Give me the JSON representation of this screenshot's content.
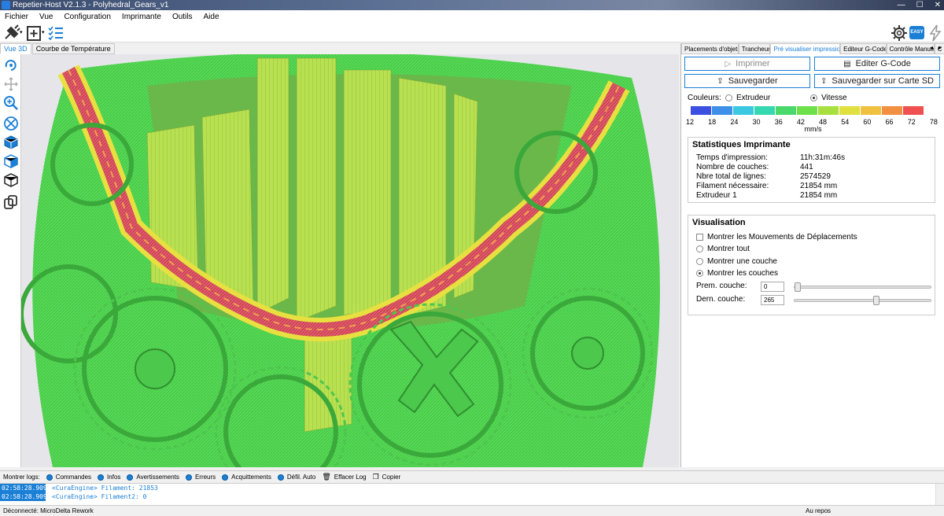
{
  "window": {
    "title": "Repetier-Host V2.1.3 - Polyhedral_Gears_v1"
  },
  "menu": [
    "Fichier",
    "Vue",
    "Configuration",
    "Imprimante",
    "Outils",
    "Aide"
  ],
  "toolbar": {
    "easy_badge": "EASY"
  },
  "view_tabs": [
    "Vue 3D",
    "Courbe de Température"
  ],
  "panel_tabs": [
    "Placements d'objets",
    "Trancheur",
    "Pré visualiser impression",
    "Editeur G-Code",
    "Contrôle Manuel",
    "C"
  ],
  "actions": {
    "print": "Imprimer",
    "edit_gcode": "Editer G-Code",
    "save": "Sauvegarder",
    "save_sd": "Sauvegarder sur Carte SD"
  },
  "colors": {
    "label": "Couleurs:",
    "option_extruder": "Extrudeur",
    "option_speed": "Vitesse",
    "selected": "Vitesse",
    "scale_values": [
      "12",
      "18",
      "24",
      "30",
      "36",
      "42",
      "48",
      "54",
      "60",
      "66",
      "72",
      "78"
    ],
    "scale_colors": [
      "#3b4fe0",
      "#3d8fe8",
      "#3bc8e0",
      "#36d8b0",
      "#4ad86a",
      "#6ee04a",
      "#a8e040",
      "#e0e040",
      "#f0c040",
      "#f09040",
      "#f05050",
      "#e040a0"
    ],
    "unit": "mm/s"
  },
  "stats": {
    "title": "Statistiques Imprimante",
    "rows": [
      {
        "label": "Temps d'impression:",
        "value": "11h:31m:46s"
      },
      {
        "label": "Nombre de couches:",
        "value": "441"
      },
      {
        "label": "Nbre total de lignes:",
        "value": "2574529"
      },
      {
        "label": "Filament nécessaire:",
        "value": "21854 mm"
      },
      {
        "label": "Extrudeur 1",
        "value": "21854 mm"
      }
    ]
  },
  "visualisation": {
    "title": "Visualisation",
    "show_moves": "Montrer les Mouvements de Déplacements",
    "show_all": "Montrer tout",
    "show_one": "Montrer une couche",
    "show_layers": "Montrer les couches",
    "selected": "Montrer les couches",
    "first_layer_label": "Prem. couche:",
    "first_layer_value": "0",
    "last_layer_label": "Dern. couche:",
    "last_layer_value": "265",
    "layer_count": 441
  },
  "log_bar": {
    "label": "Montrer logs:",
    "items": [
      "Commandes",
      "Infos",
      "Avertissements",
      "Erreurs",
      "Acquittements",
      "Défil. Auto"
    ],
    "clear": "Effacer Log",
    "copy": "Copier"
  },
  "log_lines": [
    {
      "time": "02:58:28.909",
      "msg": "<CuraEngine> Filament: 21853"
    },
    {
      "time": "02:58:28.909",
      "msg": "<CuraEngine> Filament2: 0"
    }
  ],
  "status": {
    "left": "Déconnecté: MicroDelta Rework",
    "right": "Au repos"
  }
}
